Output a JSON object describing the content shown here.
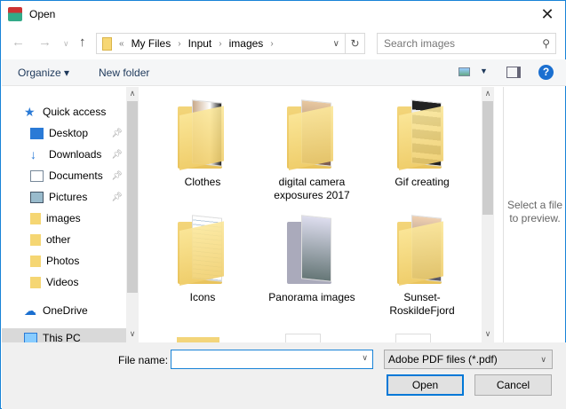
{
  "window": {
    "title": "Open",
    "close": "✕"
  },
  "address": {
    "overflow": "«",
    "crumbs": [
      "My Files",
      "Input",
      "images"
    ],
    "search_placeholder": "Search images"
  },
  "toolbar": {
    "organize": "Organize ▾",
    "new_folder": "New folder",
    "help": "?"
  },
  "nav": [
    {
      "label": "Quick access",
      "pinned": false
    },
    {
      "label": "Desktop",
      "pinned": true
    },
    {
      "label": "Downloads",
      "pinned": true
    },
    {
      "label": "Documents",
      "pinned": true
    },
    {
      "label": "Pictures",
      "pinned": true
    },
    {
      "label": "images",
      "pinned": false
    },
    {
      "label": "other",
      "pinned": false
    },
    {
      "label": "Photos",
      "pinned": false
    },
    {
      "label": "Videos",
      "pinned": false
    },
    {
      "label": "OneDrive",
      "pinned": false
    },
    {
      "label": "This PC",
      "pinned": false
    }
  ],
  "items": [
    {
      "label": "Clothes"
    },
    {
      "label": "digital camera exposures 2017"
    },
    {
      "label": "Gif creating"
    },
    {
      "label": "Icons"
    },
    {
      "label": "Panorama images"
    },
    {
      "label": "Sunset-RoskildeFjord"
    }
  ],
  "preview": {
    "text": "Select a file to preview."
  },
  "bottom": {
    "file_name_label": "File name:",
    "file_name_value": "",
    "file_type": "Adobe PDF files (*.pdf)",
    "open": "Open",
    "cancel": "Cancel"
  }
}
